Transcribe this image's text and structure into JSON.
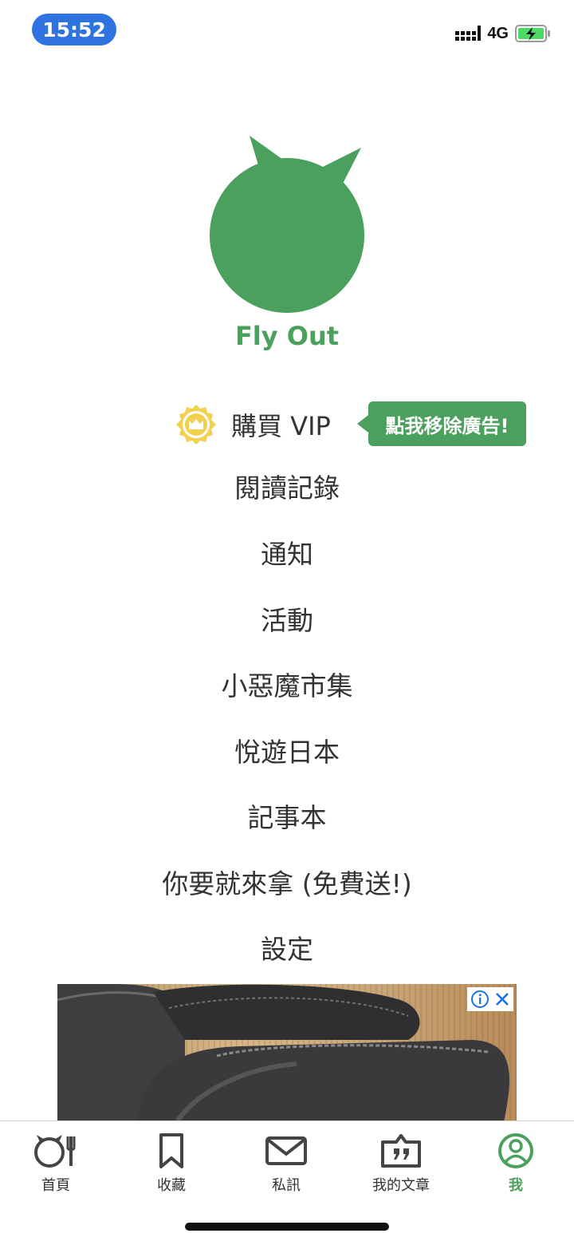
{
  "status": {
    "time": "15:52",
    "network": "4G"
  },
  "app": {
    "title": "Fly Out",
    "brand_color": "#4aa05c"
  },
  "vip": {
    "label": "購買 VIP",
    "tag": "點我移除廣告!"
  },
  "menu": {
    "items": [
      {
        "label": "閱讀記錄"
      },
      {
        "label": "通知"
      },
      {
        "label": "活動"
      },
      {
        "label": "小惡魔市集"
      },
      {
        "label": "悅遊日本"
      },
      {
        "label": "記事本"
      },
      {
        "label": "你要就來拿 (免費送!)"
      },
      {
        "label": "設定"
      }
    ]
  },
  "tabbar": {
    "tabs": [
      {
        "label": "首頁",
        "icon": "home-icon"
      },
      {
        "label": "收藏",
        "icon": "bookmark-icon"
      },
      {
        "label": "私訊",
        "icon": "mail-icon"
      },
      {
        "label": "我的文章",
        "icon": "article-icon"
      },
      {
        "label": "我",
        "icon": "profile-icon",
        "active": true
      }
    ]
  }
}
